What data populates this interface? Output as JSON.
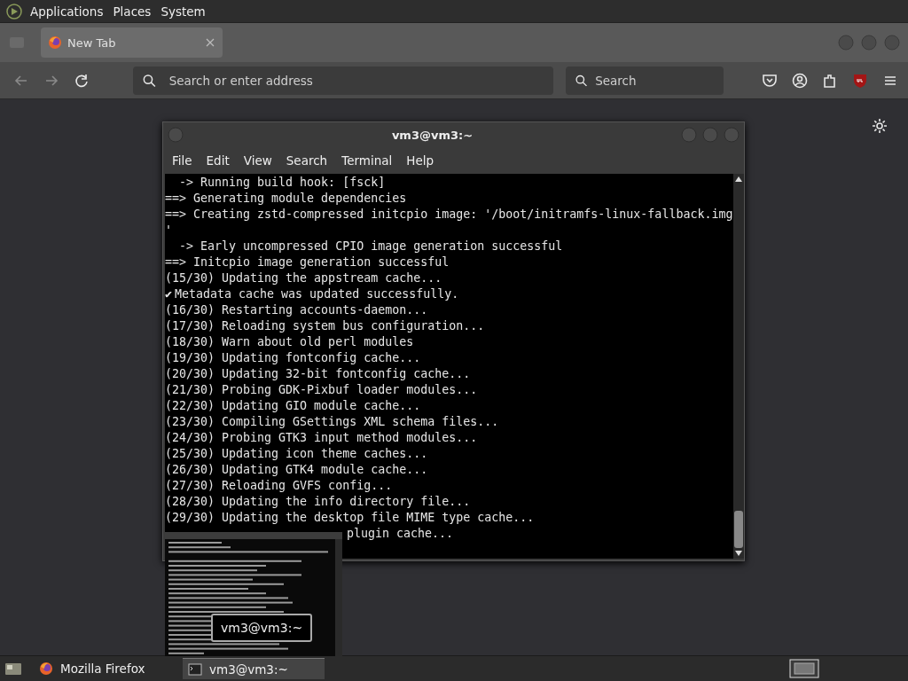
{
  "top_panel": {
    "menus": [
      "Applications",
      "Places",
      "System"
    ]
  },
  "browser": {
    "tabs": [
      {
        "label": "New Tab",
        "selected": true
      }
    ],
    "address_bar": {
      "placeholder": "Search or enter address"
    },
    "search_bar": {
      "placeholder": "Search"
    }
  },
  "terminal": {
    "title": "vm3@vm3:~",
    "menus": [
      "File",
      "Edit",
      "View",
      "Search",
      "Terminal",
      "Help"
    ],
    "lines": [
      {
        "kind": "plain",
        "text": "  -> Running build hook: [fsck]"
      },
      {
        "kind": "plain",
        "text": "==> Generating module dependencies"
      },
      {
        "kind": "plain",
        "text": "==> Creating zstd-compressed initcpio image: '/boot/initramfs-linux-fallback.img"
      },
      {
        "kind": "plain",
        "text": "'"
      },
      {
        "kind": "plain",
        "text": "  -> Early uncompressed CPIO image generation successful"
      },
      {
        "kind": "plain",
        "text": "==> Initcpio image generation successful"
      },
      {
        "kind": "plain",
        "text": "(15/30) Updating the appstream cache..."
      },
      {
        "kind": "check",
        "mark": "✔",
        "text": "Metadata cache was updated successfully."
      },
      {
        "kind": "plain",
        "text": "(16/30) Restarting accounts-daemon..."
      },
      {
        "kind": "plain",
        "text": "(17/30) Reloading system bus configuration..."
      },
      {
        "kind": "plain",
        "text": "(18/30) Warn about old perl modules"
      },
      {
        "kind": "plain",
        "text": "(19/30) Updating fontconfig cache..."
      },
      {
        "kind": "plain",
        "text": "(20/30) Updating 32-bit fontconfig cache..."
      },
      {
        "kind": "plain",
        "text": "(21/30) Probing GDK-Pixbuf loader modules..."
      },
      {
        "kind": "plain",
        "text": "(22/30) Updating GIO module cache..."
      },
      {
        "kind": "plain",
        "text": "(23/30) Compiling GSettings XML schema files..."
      },
      {
        "kind": "plain",
        "text": "(24/30) Probing GTK3 input method modules..."
      },
      {
        "kind": "plain",
        "text": "(25/30) Updating icon theme caches..."
      },
      {
        "kind": "plain",
        "text": "(26/30) Updating GTK4 module cache..."
      },
      {
        "kind": "plain",
        "text": "(27/30) Reloading GVFS config..."
      },
      {
        "kind": "plain",
        "text": "(28/30) Updating the info directory file..."
      },
      {
        "kind": "plain",
        "text": "(29/30) Updating the desktop file MIME type cache..."
      },
      {
        "kind": "covered",
        "text": "plugin cache..."
      }
    ]
  },
  "window_preview": {
    "kind": "picture",
    "label": "vm3@vm3:~"
  },
  "taskbar": {
    "tasks": [
      {
        "label": "Mozilla Firefox",
        "kind": "browser",
        "selected": false
      },
      {
        "label": "vm3@vm3:~",
        "kind": "terminal",
        "selected": true
      }
    ]
  }
}
